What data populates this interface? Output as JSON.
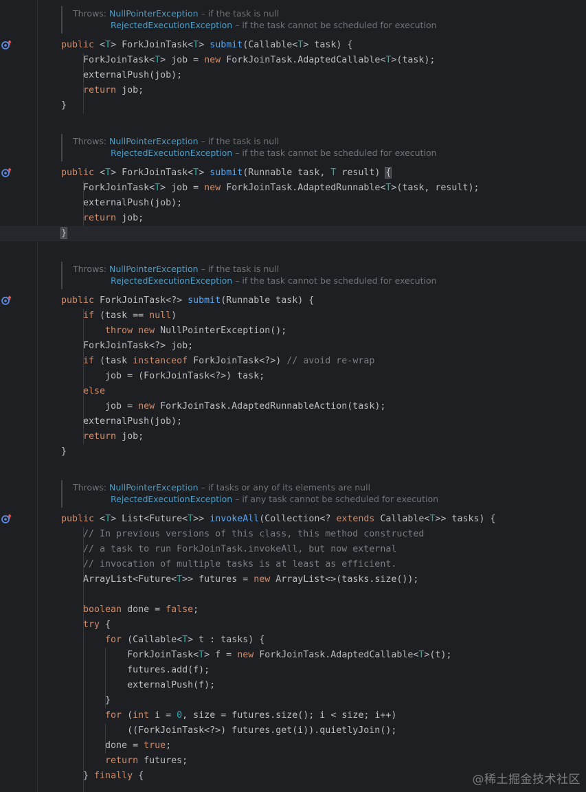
{
  "colors": {
    "background": "#1e1f22",
    "keyword": "#cf8e6d",
    "type_param": "#16baac",
    "function": "#56a8f5",
    "comment": "#7a7e85",
    "text": "#bcbec4",
    "doc_link": "#4e9cc4"
  },
  "docs": [
    {
      "throws_label": "Throws:",
      "exceptions": [
        {
          "name": "NullPointerException",
          "desc": " – if the task is null"
        },
        {
          "name": "RejectedExecutionException",
          "desc": " – if the task cannot be scheduled for execution"
        }
      ]
    },
    {
      "throws_label": "Throws:",
      "exceptions": [
        {
          "name": "NullPointerException",
          "desc": " – if the task is null"
        },
        {
          "name": "RejectedExecutionException",
          "desc": " – if the task cannot be scheduled for execution"
        }
      ]
    },
    {
      "throws_label": "Throws:",
      "exceptions": [
        {
          "name": "NullPointerException",
          "desc": " – if the task is null"
        },
        {
          "name": "RejectedExecutionException",
          "desc": " – if the task cannot be scheduled for execution"
        }
      ]
    },
    {
      "throws_label": "Throws:",
      "exceptions": [
        {
          "name": "NullPointerException",
          "desc": " – if tasks or any of its elements are null"
        },
        {
          "name": "RejectedExecutionException",
          "desc": " – if any task cannot be scheduled for execution"
        }
      ]
    }
  ],
  "gutter_icons": [
    "override-method-icon",
    "override-method-icon",
    "override-method-icon",
    "override-method-icon"
  ],
  "lines": [
    [
      [
        "kw",
        "public "
      ],
      [
        "",
        "<"
      ],
      [
        "tp",
        "T"
      ],
      [
        "",
        "> ForkJoinTask<"
      ],
      [
        "tp",
        "T"
      ],
      [
        "",
        "> "
      ],
      [
        "fn",
        "submit"
      ],
      [
        "",
        "(Callable<"
      ],
      [
        "tp",
        "T"
      ],
      [
        "",
        "> task) {"
      ]
    ],
    [
      [
        "",
        "    ForkJoinTask<"
      ],
      [
        "tp",
        "T"
      ],
      [
        "",
        "> job = "
      ],
      [
        "kw",
        "new "
      ],
      [
        "",
        "ForkJoinTask.AdaptedCallable<"
      ],
      [
        "tp",
        "T"
      ],
      [
        "",
        ">(task);"
      ]
    ],
    [
      [
        "",
        "    externalPush(job);"
      ]
    ],
    [
      [
        "kw",
        "    return "
      ],
      [
        "",
        "job;"
      ]
    ],
    [
      [
        "",
        "}"
      ]
    ],
    [
      [
        "kw",
        "public "
      ],
      [
        "",
        "<"
      ],
      [
        "tp",
        "T"
      ],
      [
        "",
        "> ForkJoinTask<"
      ],
      [
        "tp",
        "T"
      ],
      [
        "",
        "> "
      ],
      [
        "fn",
        "submit"
      ],
      [
        "",
        "(Runnable task, "
      ],
      [
        "tp",
        "T"
      ],
      [
        "",
        " result) "
      ],
      [
        "hl",
        "{"
      ]
    ],
    [
      [
        "",
        "    ForkJoinTask<"
      ],
      [
        "tp",
        "T"
      ],
      [
        "",
        "> job = "
      ],
      [
        "kw",
        "new "
      ],
      [
        "",
        "ForkJoinTask.AdaptedRunnable<"
      ],
      [
        "tp",
        "T"
      ],
      [
        "",
        ">(task, result);"
      ]
    ],
    [
      [
        "",
        "    externalPush(job);"
      ]
    ],
    [
      [
        "kw",
        "    return "
      ],
      [
        "",
        "job;"
      ]
    ],
    [
      [
        "hl",
        "}"
      ]
    ],
    [
      [
        "kw",
        "public "
      ],
      [
        "",
        "ForkJoinTask<?> "
      ],
      [
        "fn",
        "submit"
      ],
      [
        "",
        "(Runnable task) {"
      ]
    ],
    [
      [
        "kw",
        "    if "
      ],
      [
        "",
        "(task == "
      ],
      [
        "kw",
        "null"
      ],
      [
        "",
        ")"
      ]
    ],
    [
      [
        "kw",
        "        throw new "
      ],
      [
        "",
        "NullPointerException();"
      ]
    ],
    [
      [
        "",
        "    ForkJoinTask<?> job;"
      ]
    ],
    [
      [
        "kw",
        "    if "
      ],
      [
        "",
        "(task "
      ],
      [
        "kw",
        "instanceof "
      ],
      [
        "",
        "ForkJoinTask<?>) "
      ],
      [
        "cm",
        "// avoid re-wrap"
      ]
    ],
    [
      [
        "",
        "        job = (ForkJoinTask<?>) task;"
      ]
    ],
    [
      [
        "kw",
        "    else"
      ]
    ],
    [
      [
        "",
        "        job = "
      ],
      [
        "kw",
        "new "
      ],
      [
        "",
        "ForkJoinTask.AdaptedRunnableAction(task);"
      ]
    ],
    [
      [
        "",
        "    externalPush(job);"
      ]
    ],
    [
      [
        "kw",
        "    return "
      ],
      [
        "",
        "job;"
      ]
    ],
    [
      [
        "",
        "}"
      ]
    ],
    [
      [
        "kw",
        "public "
      ],
      [
        "",
        "<"
      ],
      [
        "tp",
        "T"
      ],
      [
        "",
        "> List<Future<"
      ],
      [
        "tp",
        "T"
      ],
      [
        "",
        ">> "
      ],
      [
        "fn",
        "invokeAll"
      ],
      [
        "",
        "(Collection<? "
      ],
      [
        "kw",
        "extends "
      ],
      [
        "",
        "Callable<"
      ],
      [
        "tp",
        "T"
      ],
      [
        "",
        ">> tasks) {"
      ]
    ],
    [
      [
        "cm",
        "    // In previous versions of this class, this method constructed"
      ]
    ],
    [
      [
        "cm",
        "    // a task to run ForkJoinTask.invokeAll, but now external"
      ]
    ],
    [
      [
        "cm",
        "    // invocation of multiple tasks is at least as efficient."
      ]
    ],
    [
      [
        "",
        "    ArrayList<Future<"
      ],
      [
        "tp",
        "T"
      ],
      [
        "",
        ">> futures = "
      ],
      [
        "kw",
        "new "
      ],
      [
        "",
        "ArrayList<>(tasks.size());"
      ]
    ],
    [
      [
        "",
        ""
      ]
    ],
    [
      [
        "kw",
        "    boolean "
      ],
      [
        "",
        "done = "
      ],
      [
        "kw",
        "false"
      ],
      [
        "",
        ";"
      ]
    ],
    [
      [
        "kw",
        "    try "
      ],
      [
        "",
        "{"
      ]
    ],
    [
      [
        "kw",
        "        for "
      ],
      [
        "",
        "(Callable<"
      ],
      [
        "tp",
        "T"
      ],
      [
        "",
        "> t : tasks) {"
      ]
    ],
    [
      [
        "",
        "            ForkJoinTask<"
      ],
      [
        "tp",
        "T"
      ],
      [
        "",
        "> f = "
      ],
      [
        "kw",
        "new "
      ],
      [
        "",
        "ForkJoinTask.AdaptedCallable<"
      ],
      [
        "tp",
        "T"
      ],
      [
        "",
        ">(t);"
      ]
    ],
    [
      [
        "",
        "            futures.add(f);"
      ]
    ],
    [
      [
        "",
        "            externalPush(f);"
      ]
    ],
    [
      [
        "",
        "        }"
      ]
    ],
    [
      [
        "kw",
        "        for "
      ],
      [
        "",
        "("
      ],
      [
        "kw",
        "int "
      ],
      [
        "",
        "i = "
      ],
      [
        "nm",
        "0"
      ],
      [
        "",
        ", size = futures.size(); i < size; i++)"
      ]
    ],
    [
      [
        "",
        "            ((ForkJoinTask<?>) futures.get(i)).quietlyJoin();"
      ]
    ],
    [
      [
        "",
        "        done = "
      ],
      [
        "kw",
        "true"
      ],
      [
        "",
        ";"
      ]
    ],
    [
      [
        "kw",
        "        return "
      ],
      [
        "",
        "futures;"
      ]
    ],
    [
      [
        "",
        "    } "
      ],
      [
        "kw",
        "finally "
      ],
      [
        "",
        "{"
      ]
    ]
  ],
  "watermark": "@稀土掘金技术社区"
}
